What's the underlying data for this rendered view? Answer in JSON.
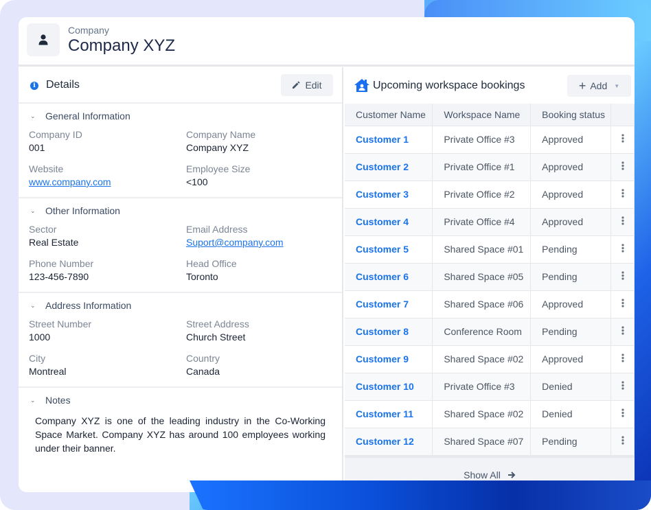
{
  "header": {
    "label": "Company",
    "title": "Company XYZ",
    "icon": "user-icon"
  },
  "details": {
    "title": "Details",
    "icon": "info-icon",
    "edit_label": "Edit",
    "sections": [
      {
        "title": "General Information",
        "fields": [
          {
            "label": "Company ID",
            "value": "001"
          },
          {
            "label": "Company Name",
            "value": "Company XYZ"
          },
          {
            "label": "Website",
            "value": "www.company.com",
            "link": true
          },
          {
            "label": "Employee Size",
            "value": "<100"
          }
        ]
      },
      {
        "title": "Other Information",
        "fields": [
          {
            "label": "Sector",
            "value": "Real Estate"
          },
          {
            "label": "Email Address",
            "value": "Suport@company.com",
            "link": true
          },
          {
            "label": "Phone Number",
            "value": "123-456-7890"
          },
          {
            "label": "Head Office",
            "value": "Toronto"
          }
        ]
      },
      {
        "title": "Address Information",
        "fields": [
          {
            "label": "Street Number",
            "value": "1000"
          },
          {
            "label": "Street Address",
            "value": "Church Street"
          },
          {
            "label": "City",
            "value": "Montreal"
          },
          {
            "label": "Country",
            "value": "Canada"
          }
        ]
      }
    ],
    "notes": {
      "title": "Notes",
      "text": "Company XYZ is one of the leading industry in the Co-Working Space Market. Company XYZ has around 100 employees working under their banner."
    }
  },
  "bookings": {
    "title": "Upcoming workspace bookings",
    "icon": "home-user-icon",
    "add_label": "Add",
    "columns": [
      "Customer Name",
      "Workspace Name",
      "Booking status",
      ""
    ],
    "rows": [
      {
        "customer": "Customer 1",
        "workspace": "Private Office #3",
        "status": "Approved"
      },
      {
        "customer": "Customer 2",
        "workspace": "Private Office #1",
        "status": "Approved"
      },
      {
        "customer": "Customer 3",
        "workspace": "Private Office #2",
        "status": "Approved"
      },
      {
        "customer": "Customer 4",
        "workspace": "Private Office #4",
        "status": "Approved"
      },
      {
        "customer": "Customer 5",
        "workspace": "Shared Space #01",
        "status": "Pending"
      },
      {
        "customer": "Customer 6",
        "workspace": "Shared Space #05",
        "status": "Pending"
      },
      {
        "customer": "Customer 7",
        "workspace": "Shared Space #06",
        "status": "Approved"
      },
      {
        "customer": "Customer 8",
        "workspace": "Conference Room",
        "status": "Pending"
      },
      {
        "customer": "Customer 9",
        "workspace": "Shared Space #02",
        "status": "Approved"
      },
      {
        "customer": "Customer 10",
        "workspace": "Private Office #3",
        "status": "Denied"
      },
      {
        "customer": "Customer 11",
        "workspace": "Shared Space #02",
        "status": "Denied"
      },
      {
        "customer": "Customer 12",
        "workspace": "Shared Space #07",
        "status": "Pending"
      }
    ],
    "show_all_label": "Show All"
  },
  "colors": {
    "accent": "#1a73e8",
    "text": "#1e293b",
    "muted": "#7c8595"
  }
}
